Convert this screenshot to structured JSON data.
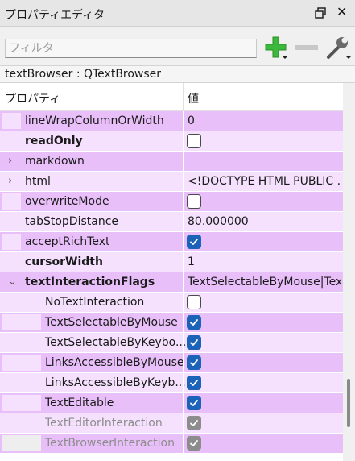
{
  "window": {
    "title": "プロパティエディタ"
  },
  "toolbar": {
    "filter_placeholder": "フィルタ",
    "filter_value": ""
  },
  "object_label": "textBrowser : QTextBrowser",
  "header": {
    "property": "プロパティ",
    "value": "値"
  },
  "colors": {
    "row_dark": "#e8bff8",
    "row_light": "#f5e1fd",
    "check_blue": "#1b63b8",
    "check_disabled": "#8c8c8c",
    "plus_green": "#3cb93c"
  },
  "rows": [
    {
      "name": "lineWrapColumnOrWidth",
      "value": "0"
    },
    {
      "name": "readOnly",
      "checked": false
    },
    {
      "name": "markdown",
      "value": ""
    },
    {
      "name": "html",
      "value": "<!DOCTYPE HTML PUBLIC ..."
    },
    {
      "name": "overwriteMode",
      "checked": false
    },
    {
      "name": "tabStopDistance",
      "value": "80.000000"
    },
    {
      "name": "acceptRichText",
      "checked": true
    },
    {
      "name": "cursorWidth",
      "value": "1"
    },
    {
      "name": "textInteractionFlags",
      "value": "TextSelectableByMouse|Tex..."
    },
    {
      "name": "NoTextInteraction",
      "checked": false
    },
    {
      "name": "TextSelectableByMouse",
      "checked": true
    },
    {
      "name": "TextSelectableByKeybo...",
      "checked": true
    },
    {
      "name": "LinksAccessibleByMouse",
      "checked": true
    },
    {
      "name": "LinksAccessibleByKeyb...",
      "checked": true
    },
    {
      "name": "TextEditable",
      "checked": true
    },
    {
      "name": "TextEditorInteraction",
      "checked": true,
      "disabled": true
    },
    {
      "name": "TextBrowserInteraction",
      "checked": true,
      "disabled": true
    }
  ]
}
